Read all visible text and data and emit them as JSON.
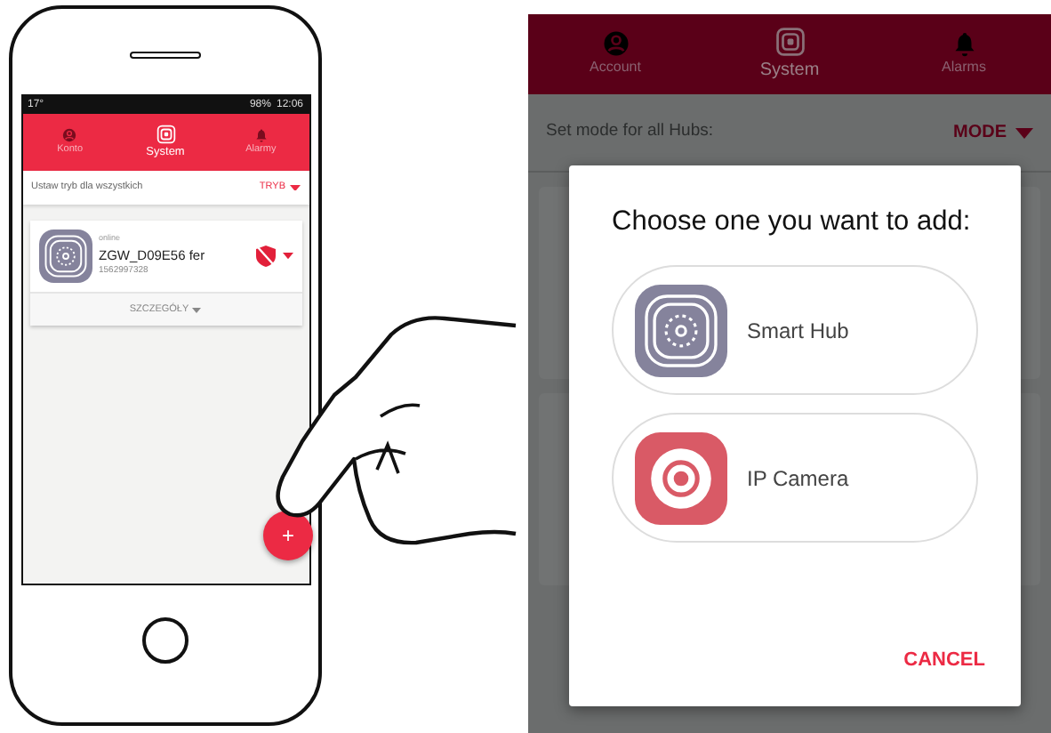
{
  "phone": {
    "status_bar": {
      "temperature": "17°",
      "battery": "98%",
      "time": "12:06"
    },
    "tabs": [
      {
        "label": "Konto",
        "selected": false,
        "kind": "account"
      },
      {
        "label": "System",
        "selected": true,
        "kind": "system"
      },
      {
        "label": "Alarmy",
        "selected": false,
        "kind": "alarms"
      }
    ],
    "mode_row": {
      "label": "Ustaw tryb dla wszystkich",
      "button": "TRYB"
    },
    "device": {
      "status": "online",
      "name": "ZGW_D09E56 fer",
      "number": "1562997328",
      "details": "SZCZEGÓŁY"
    },
    "fab": "+"
  },
  "zoomed": {
    "tabs": [
      {
        "label": "Account",
        "selected": false,
        "kind": "account"
      },
      {
        "label": "System",
        "selected": true,
        "kind": "system"
      },
      {
        "label": "Alarms",
        "selected": false,
        "kind": "alarms"
      }
    ],
    "mode_row": {
      "label": "Set mode for all Hubs:",
      "button": "MODE"
    },
    "dialog": {
      "title": "Choose one you want to add:",
      "options": [
        {
          "kind": "hub",
          "label": "Smart Hub"
        },
        {
          "kind": "camera",
          "label": "IP Camera"
        }
      ],
      "cancel": "CANCEL"
    }
  }
}
